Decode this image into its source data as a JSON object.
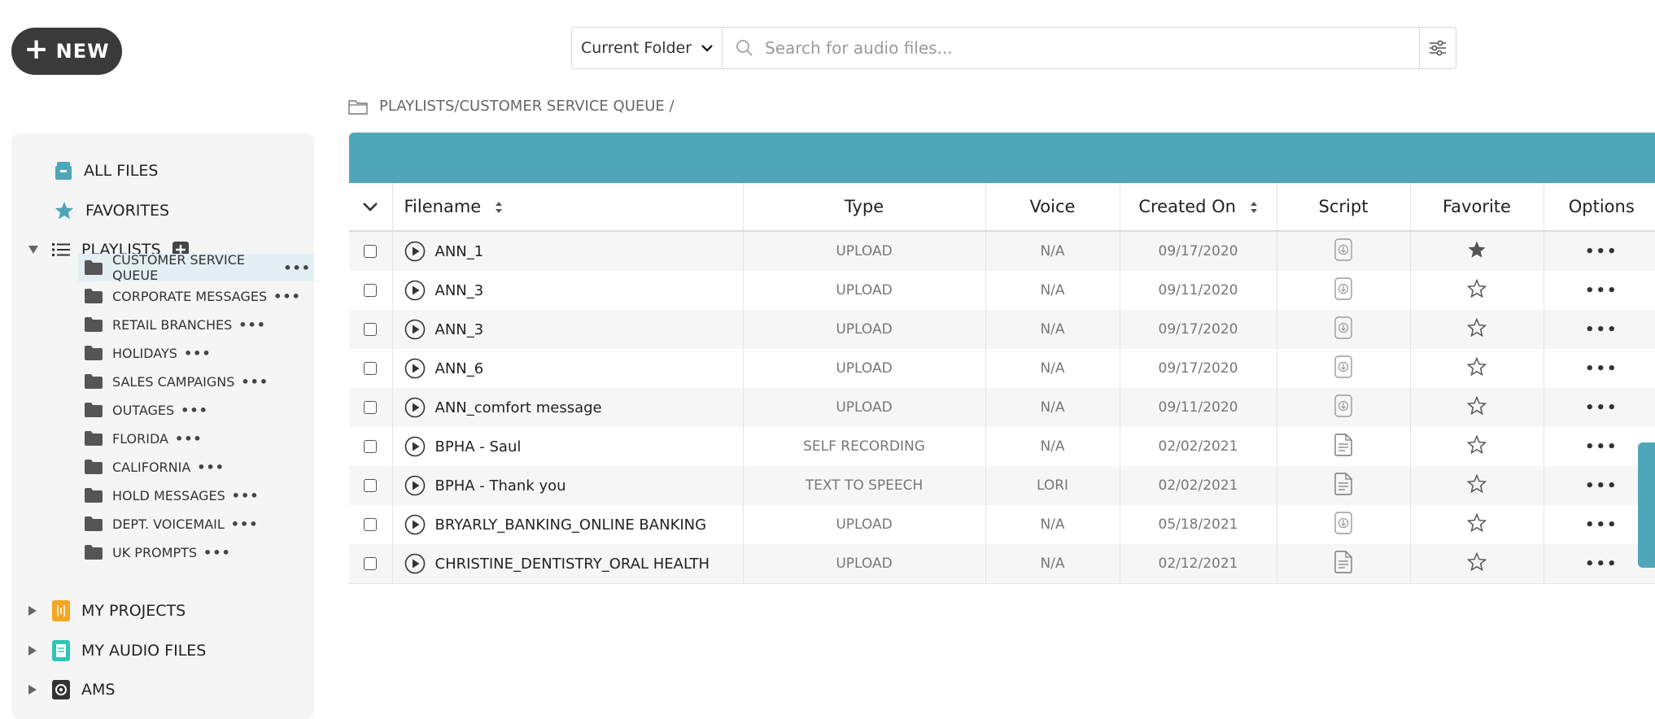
{
  "new_button": {
    "label": "NEW"
  },
  "search": {
    "scope": "Current Folder",
    "placeholder": "Search for audio files...",
    "value": ""
  },
  "breadcrumb": {
    "path": "PLAYLISTS/CUSTOMER SERVICE QUEUE /"
  },
  "sidebar": {
    "all_files": "ALL FILES",
    "favorites": "FAVORITES",
    "playlists": "PLAYLISTS",
    "playlist_items": [
      {
        "label": "CUSTOMER SERVICE QUEUE",
        "selected": true
      },
      {
        "label": "CORPORATE MESSAGES"
      },
      {
        "label": "RETAIL BRANCHES"
      },
      {
        "label": "HOLIDAYS"
      },
      {
        "label": "SALES CAMPAIGNS"
      },
      {
        "label": "OUTAGES"
      },
      {
        "label": "FLORIDA"
      },
      {
        "label": "CALIFORNIA"
      },
      {
        "label": "HOLD MESSAGES"
      },
      {
        "label": "DEPT. VOICEMAIL"
      },
      {
        "label": "UK PROMPTS"
      }
    ],
    "more_glyph": "•••",
    "my_projects": "MY PROJECTS",
    "my_audio_files": "MY AUDIO FILES",
    "ams": "AMS"
  },
  "table": {
    "headers": {
      "filename": "Filename",
      "type": "Type",
      "voice": "Voice",
      "created_on": "Created On",
      "script": "Script",
      "favorite": "Favorite",
      "options": "Options"
    },
    "options_glyph": "•••",
    "rows": [
      {
        "filename": "ANN_1",
        "type": "UPLOAD",
        "voice": "N/A",
        "created": "09/17/2020",
        "script": "download",
        "favorite": true
      },
      {
        "filename": "ANN_3",
        "type": "UPLOAD",
        "voice": "N/A",
        "created": "09/11/2020",
        "script": "download",
        "favorite": false
      },
      {
        "filename": "ANN_3",
        "type": "UPLOAD",
        "voice": "N/A",
        "created": "09/17/2020",
        "script": "download",
        "favorite": false
      },
      {
        "filename": "ANN_6",
        "type": "UPLOAD",
        "voice": "N/A",
        "created": "09/17/2020",
        "script": "download",
        "favorite": false
      },
      {
        "filename": "ANN_comfort message",
        "type": "UPLOAD",
        "voice": "N/A",
        "created": "09/11/2020",
        "script": "download",
        "favorite": false
      },
      {
        "filename": "BPHA - Saul",
        "type": "SELF RECORDING",
        "voice": "N/A",
        "created": "02/02/2021",
        "script": "document",
        "favorite": false
      },
      {
        "filename": "BPHA - Thank you",
        "type": "TEXT TO SPEECH",
        "voice": "LORI",
        "created": "02/02/2021",
        "script": "document",
        "favorite": false
      },
      {
        "filename": "BRYARLY_BANKING_ONLINE BANKING",
        "type": "UPLOAD",
        "voice": "N/A",
        "created": "05/18/2021",
        "script": "download",
        "favorite": false
      },
      {
        "filename": "CHRISTINE_DENTISTRY_ORAL HEALTH",
        "type": "UPLOAD",
        "voice": "N/A",
        "created": "02/12/2021",
        "script": "document",
        "favorite": false
      }
    ]
  },
  "colors": {
    "accent": "#4fa6b8",
    "new_button": "#3a3a3a",
    "projects_icon": "#f5a623",
    "audio_files_icon": "#2ec4b6",
    "ams_icon": "#333333"
  }
}
